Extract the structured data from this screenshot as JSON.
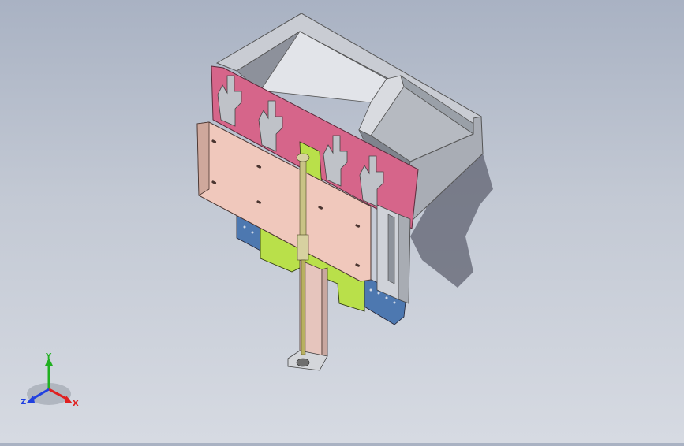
{
  "view": {
    "background_top": "#a9b2c3",
    "background_bottom": "#d6dae2"
  },
  "model": {
    "parts": [
      {
        "name": "hopper",
        "color": "#b8bcc4"
      },
      {
        "name": "mounting-plate-front",
        "color": "#f0c8bc"
      },
      {
        "name": "finger-guide-plate",
        "color": "#d6658a"
      },
      {
        "name": "bracket",
        "color": "#b9e04a"
      },
      {
        "name": "side-rail",
        "color": "#4d78b0"
      },
      {
        "name": "vertical-column",
        "color": "#e6c5bd"
      },
      {
        "name": "cylinder-rod",
        "color": "#b8b060"
      }
    ]
  },
  "triad": {
    "x_label": "X",
    "y_label": "Y",
    "z_label": "Z",
    "x_color": "#e02020",
    "y_color": "#20b020",
    "z_color": "#2040e0"
  }
}
